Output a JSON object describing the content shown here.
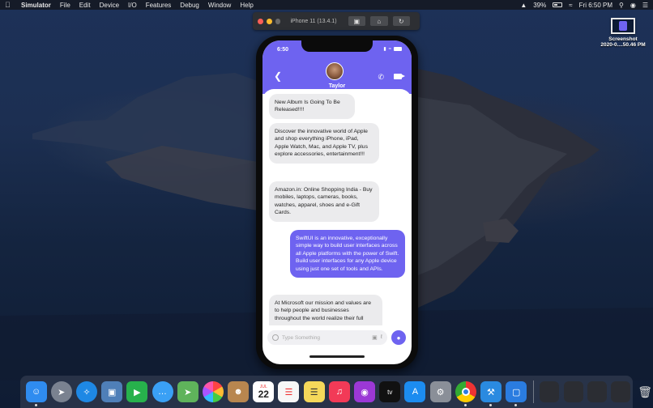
{
  "menubar": {
    "app_name": "Simulator",
    "items": [
      "File",
      "Edit",
      "Device",
      "I/O",
      "Features",
      "Debug",
      "Window",
      "Help"
    ],
    "battery": "39%",
    "clock": "Fri 6:50 PM"
  },
  "simulator": {
    "device_title": "iPhone 11 (13.4.1)"
  },
  "phone": {
    "status_time": "6:50",
    "contact_name": "Taylor",
    "messages": [
      {
        "direction": "in",
        "text": "New Album Is Going To Be Released!!!!"
      },
      {
        "direction": "in",
        "text": "Discover the innovative world of Apple and shop everything iPhone, iPad, Apple Watch, Mac, and Apple TV, plus explore accessories, entertainment!!!"
      },
      {
        "direction": "in",
        "text": "Amazon.in: Online Shopping India - Buy mobiles, laptops, cameras, books, watches, apparel, shoes and e-Gift Cards."
      },
      {
        "direction": "out",
        "text": "SwiftUI is an innovative, exceptionally simple way to build user interfaces across all Apple platforms with the power of Swift. Build user interfaces for any Apple device using just one set of tools and APIs."
      },
      {
        "direction": "in",
        "text": "At Microsoft our mission and values are to help people and businesses throughout the world realize their full"
      }
    ],
    "input_placeholder": "Type Something",
    "accent_color": "#6e63f0"
  },
  "desktop": {
    "file_name_line1": "Screenshot",
    "file_name_line2": "2020-0....50.46 PM"
  },
  "dock": {
    "items": [
      {
        "name": "finder-icon",
        "color": "#2f8cf0"
      },
      {
        "name": "launchpad-icon",
        "color": "#7a8290"
      },
      {
        "name": "safari-icon",
        "color": "#1e88e5"
      },
      {
        "name": "preview-icon",
        "color": "#4f7fb8"
      },
      {
        "name": "facetime-icon",
        "color": "#27b14c"
      },
      {
        "name": "messages-icon",
        "color": "#3aa0f5"
      },
      {
        "name": "maps-icon",
        "color": "#5fb35b"
      },
      {
        "name": "photos-icon",
        "color": "#f2f2f2"
      },
      {
        "name": "contacts-icon",
        "color": "#b8864f"
      },
      {
        "name": "calendar-icon",
        "color": "#ffffff"
      },
      {
        "name": "reminders-icon",
        "color": "#f7f7f7"
      },
      {
        "name": "notes-icon",
        "color": "#f5d85a"
      },
      {
        "name": "music-icon",
        "color": "#f23a57"
      },
      {
        "name": "podcasts-icon",
        "color": "#9b38d6"
      },
      {
        "name": "apple-tv-icon",
        "color": "#111111"
      },
      {
        "name": "app-store-icon",
        "color": "#1c8cf0"
      },
      {
        "name": "system-preferences-icon",
        "color": "#8a8f98"
      },
      {
        "name": "chrome-icon",
        "color": "#e9e9e9"
      },
      {
        "name": "xcode-icon",
        "color": "#2a8ae0"
      },
      {
        "name": "simulator-icon",
        "color": "#2a7ce0"
      }
    ],
    "calendar_month": "JUL",
    "calendar_day": "22",
    "apple_tv_label": "tv"
  }
}
